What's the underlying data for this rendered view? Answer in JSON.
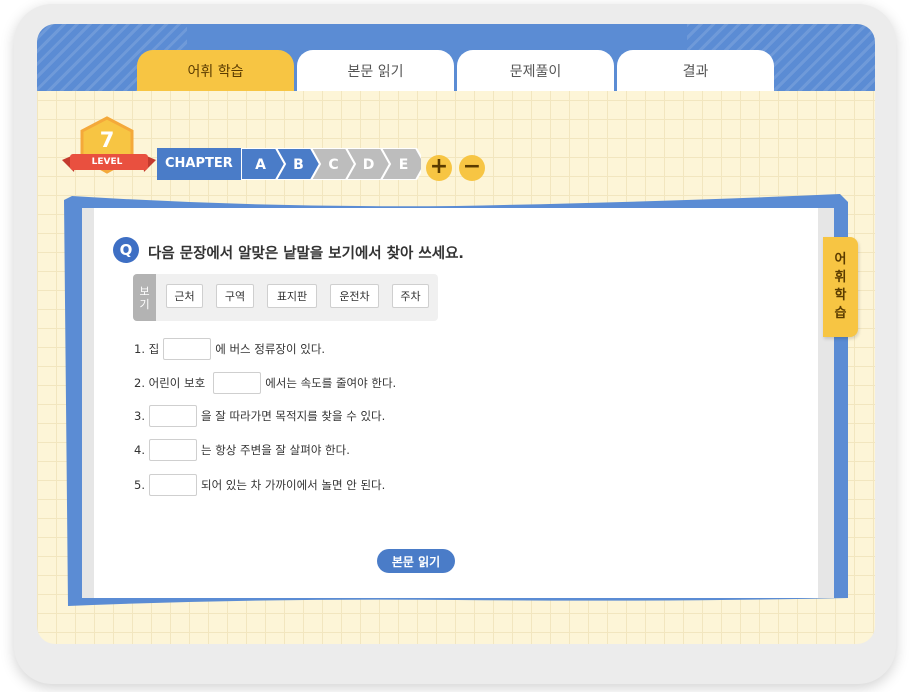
{
  "tabs": [
    {
      "label": "어휘 학습",
      "active": true
    },
    {
      "label": "본문 읽기",
      "active": false
    },
    {
      "label": "문제풀이",
      "active": false
    },
    {
      "label": "결과",
      "active": false
    }
  ],
  "level": {
    "number": "7",
    "label": "LEVEL"
  },
  "chapter": {
    "label": "CHAPTER",
    "steps": [
      "A",
      "B",
      "C",
      "D",
      "E"
    ],
    "completed_steps": 2
  },
  "controls": {
    "plus": "+",
    "minus": "−"
  },
  "side_tab": [
    "어",
    "휘",
    "학",
    "습"
  ],
  "question": {
    "badge": "Q",
    "text": "다음 문장에서 알맞은 낱말을 보기에서 찾아 쓰세요."
  },
  "word_box": {
    "label": [
      "보",
      "기"
    ],
    "words": [
      "근처",
      "구역",
      "표지판",
      "운전차",
      "주차"
    ]
  },
  "items": [
    {
      "before": "1. 집",
      "after": "에 버스 정류장이 있다.",
      "value": ""
    },
    {
      "before": "2. 어린이 보호",
      "after": "에서는 속도를 줄여야 한다.",
      "value": ""
    },
    {
      "before": "3.",
      "after": "을 잘 따라가면 목적지를 찾을 수 있다.",
      "value": ""
    },
    {
      "before": "4.",
      "after": "는 항상 주변을 잘 살펴야 한다.",
      "value": ""
    },
    {
      "before": "5.",
      "after": "되어 있는 차 가까이에서 놀면 안 된다.",
      "value": ""
    }
  ],
  "next_button": "본문 읽기",
  "colors": {
    "primary_blue": "#5b8cd4",
    "dark_blue": "#4a7cc8",
    "accent_yellow": "#f7c543",
    "ribbon_red": "#e9503f",
    "inactive_step": "#bdbdbd",
    "grid_background": "#fdf5d7"
  }
}
